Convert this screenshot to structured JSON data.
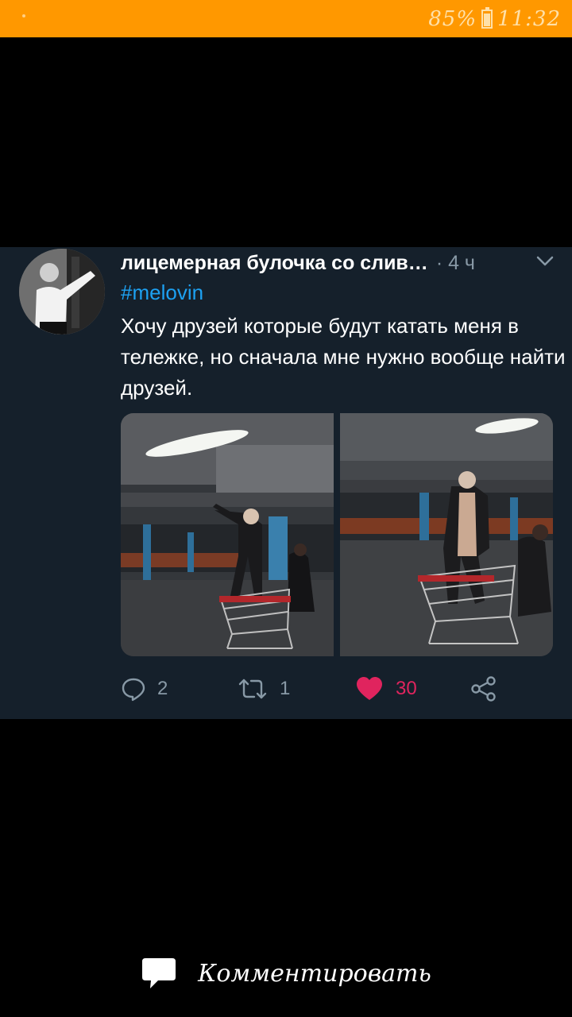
{
  "status_bar": {
    "battery": "85%",
    "time": "11:32",
    "color": "#ff9800"
  },
  "tweet": {
    "author_name": "лицемерная булочка со слив…",
    "time": "· 4 ч",
    "hashtag": "#melovin",
    "text": "Хочу друзей которые будут катать меня в тележке, но сначала мне нужно вообще найти друзей.",
    "avatar_icon": "avatar",
    "caret_icon": "chevron-down-icon",
    "actions": {
      "reply_count": "2",
      "retweet_count": "1",
      "like_count": "30",
      "liked": true,
      "like_color": "#e0245e"
    }
  },
  "comment_button": {
    "label": "Комментировать",
    "icon": "speech-bubble-icon"
  }
}
